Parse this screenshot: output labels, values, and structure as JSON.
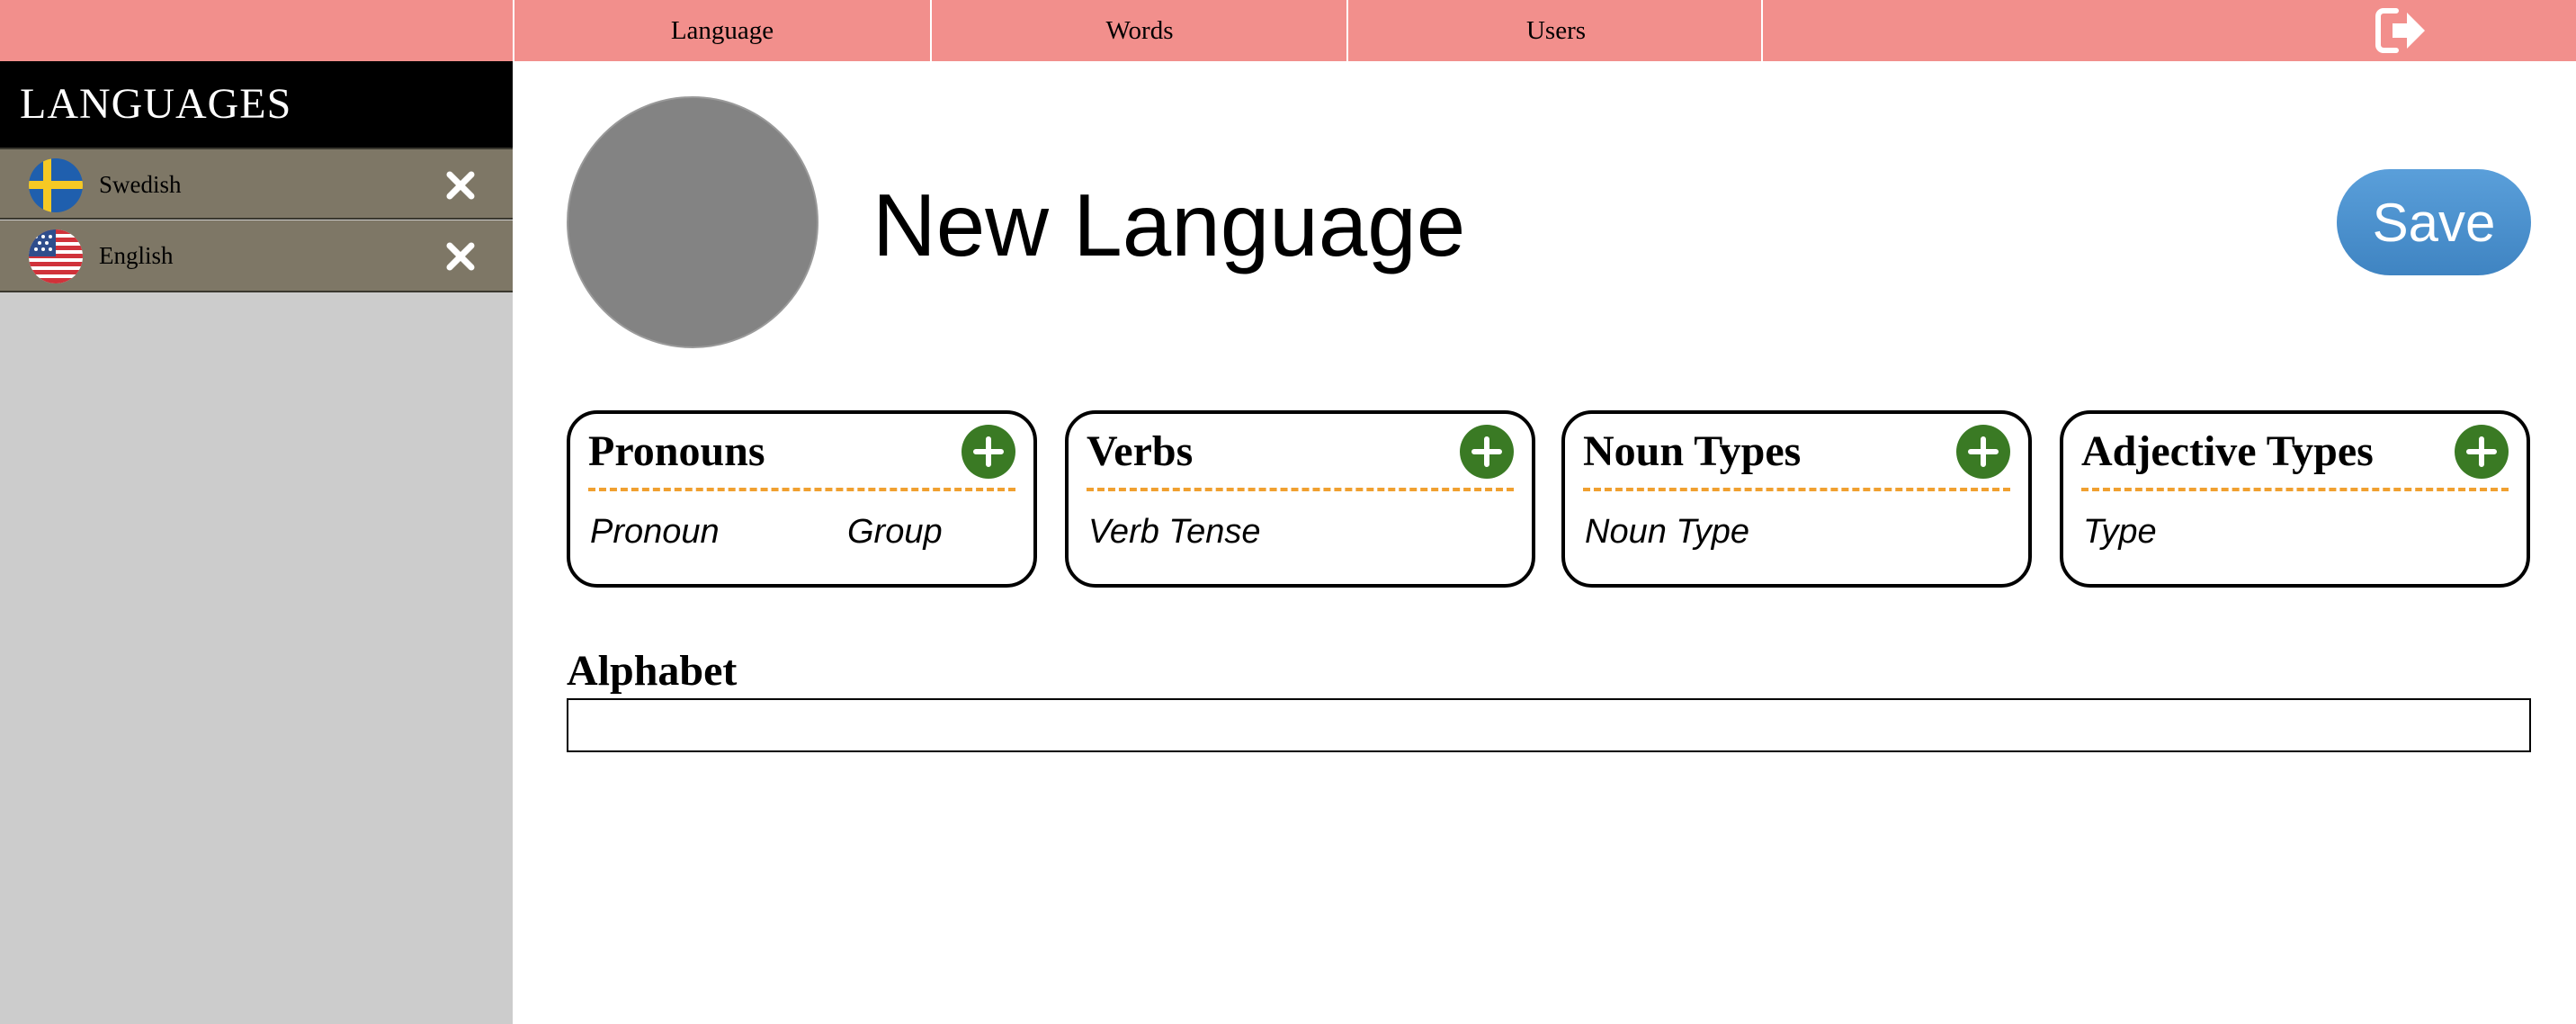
{
  "nav": {
    "tabs": [
      "Language",
      "Words",
      "Users"
    ],
    "logout_icon": "sign-out-icon",
    "background_color": "#f28f8c"
  },
  "sidebar": {
    "title": "LANGUAGES",
    "items": [
      {
        "label": "Swedish",
        "flag_icon": "sweden-flag-icon",
        "delete_icon": "close-icon"
      },
      {
        "label": "English",
        "flag_icon": "us-flag-icon",
        "delete_icon": "close-icon"
      }
    ]
  },
  "main": {
    "title": "New Language",
    "save_label": "Save",
    "avatar_icon": "language-avatar-placeholder",
    "cards": [
      {
        "title": "Pronouns",
        "columns": [
          "Pronoun",
          "Group"
        ],
        "add_icon": "plus-icon"
      },
      {
        "title": "Verbs",
        "columns": [
          "Verb Tense"
        ],
        "add_icon": "plus-icon"
      },
      {
        "title": "Noun Types",
        "columns": [
          "Noun Type"
        ],
        "add_icon": "plus-icon"
      },
      {
        "title": "Adjective Types",
        "columns": [
          "Type"
        ],
        "add_icon": "plus-icon"
      }
    ],
    "alphabet": {
      "label": "Alphabet",
      "value": "",
      "placeholder": ""
    }
  },
  "colors": {
    "accent_blue": "#4a90d0",
    "add_green": "#3a7a24",
    "sidebar_item": "#7e7766",
    "divider_orange": "#f0a030"
  }
}
